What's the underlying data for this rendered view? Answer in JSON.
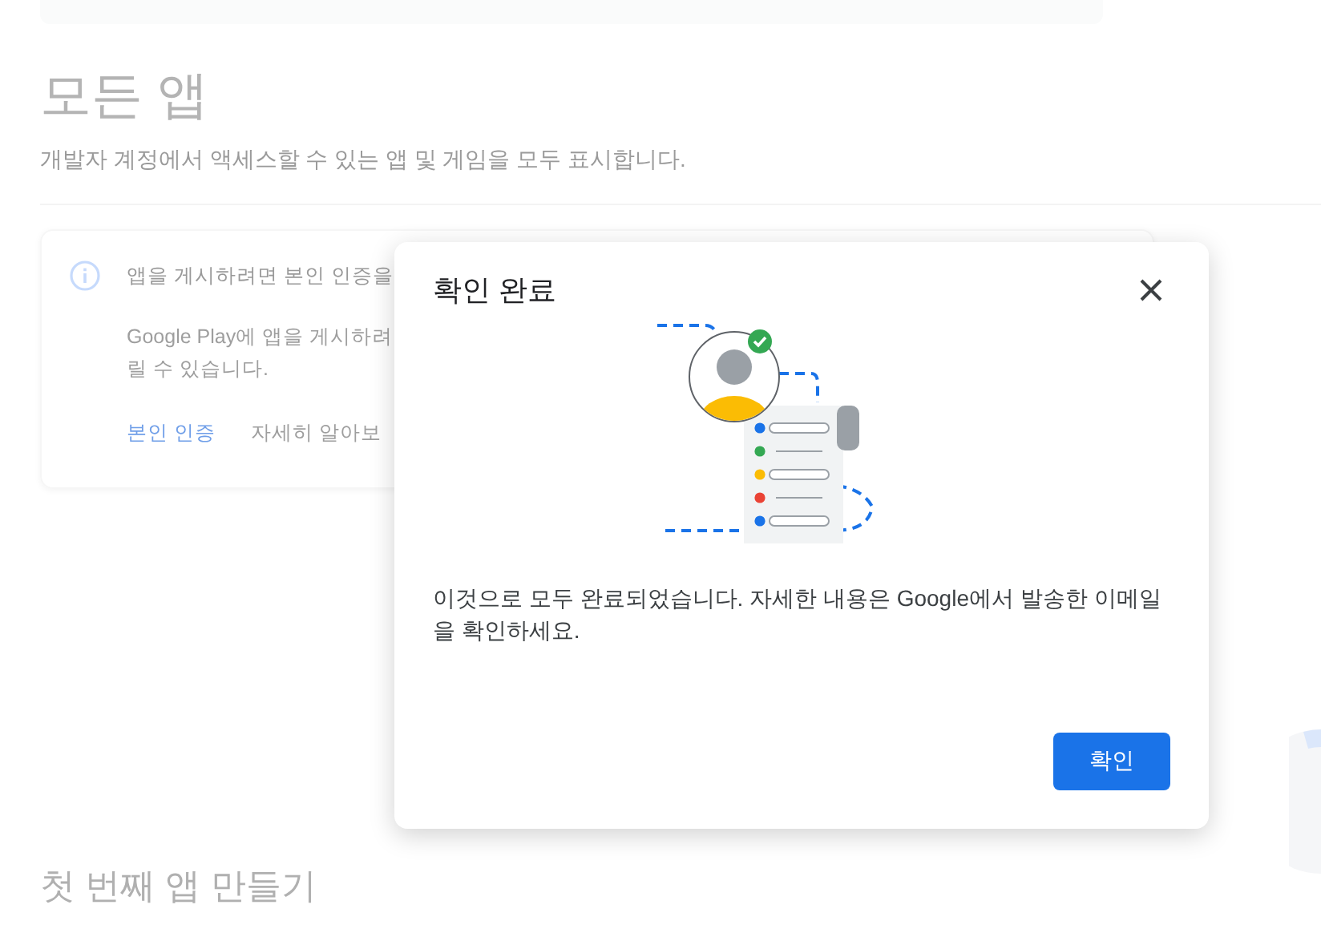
{
  "background": {
    "header": "모든 앱",
    "subtitle": "개발자 계정에서 액세스할 수 있는 앱 및 게임을 모두 표시합니다.",
    "notice": {
      "title": "앱을 게시하려면 본인 인증을",
      "body_lines": [
        "Google Play에 앱을 게시하려",
        "릴 수 있습니다."
      ],
      "links": [
        {
          "label": "본인 인증",
          "kind": "primary"
        },
        {
          "label": "자세히 알아보",
          "kind": "secondary"
        }
      ]
    },
    "section_title": "첫 번째 앱 만들기"
  },
  "dialog": {
    "title": "확인 완료",
    "message": "이것으로 모두 완료되었습니다. 자세한 내용은 Google에서 발송한 이메일을 확인하세요.",
    "button": "확인"
  }
}
